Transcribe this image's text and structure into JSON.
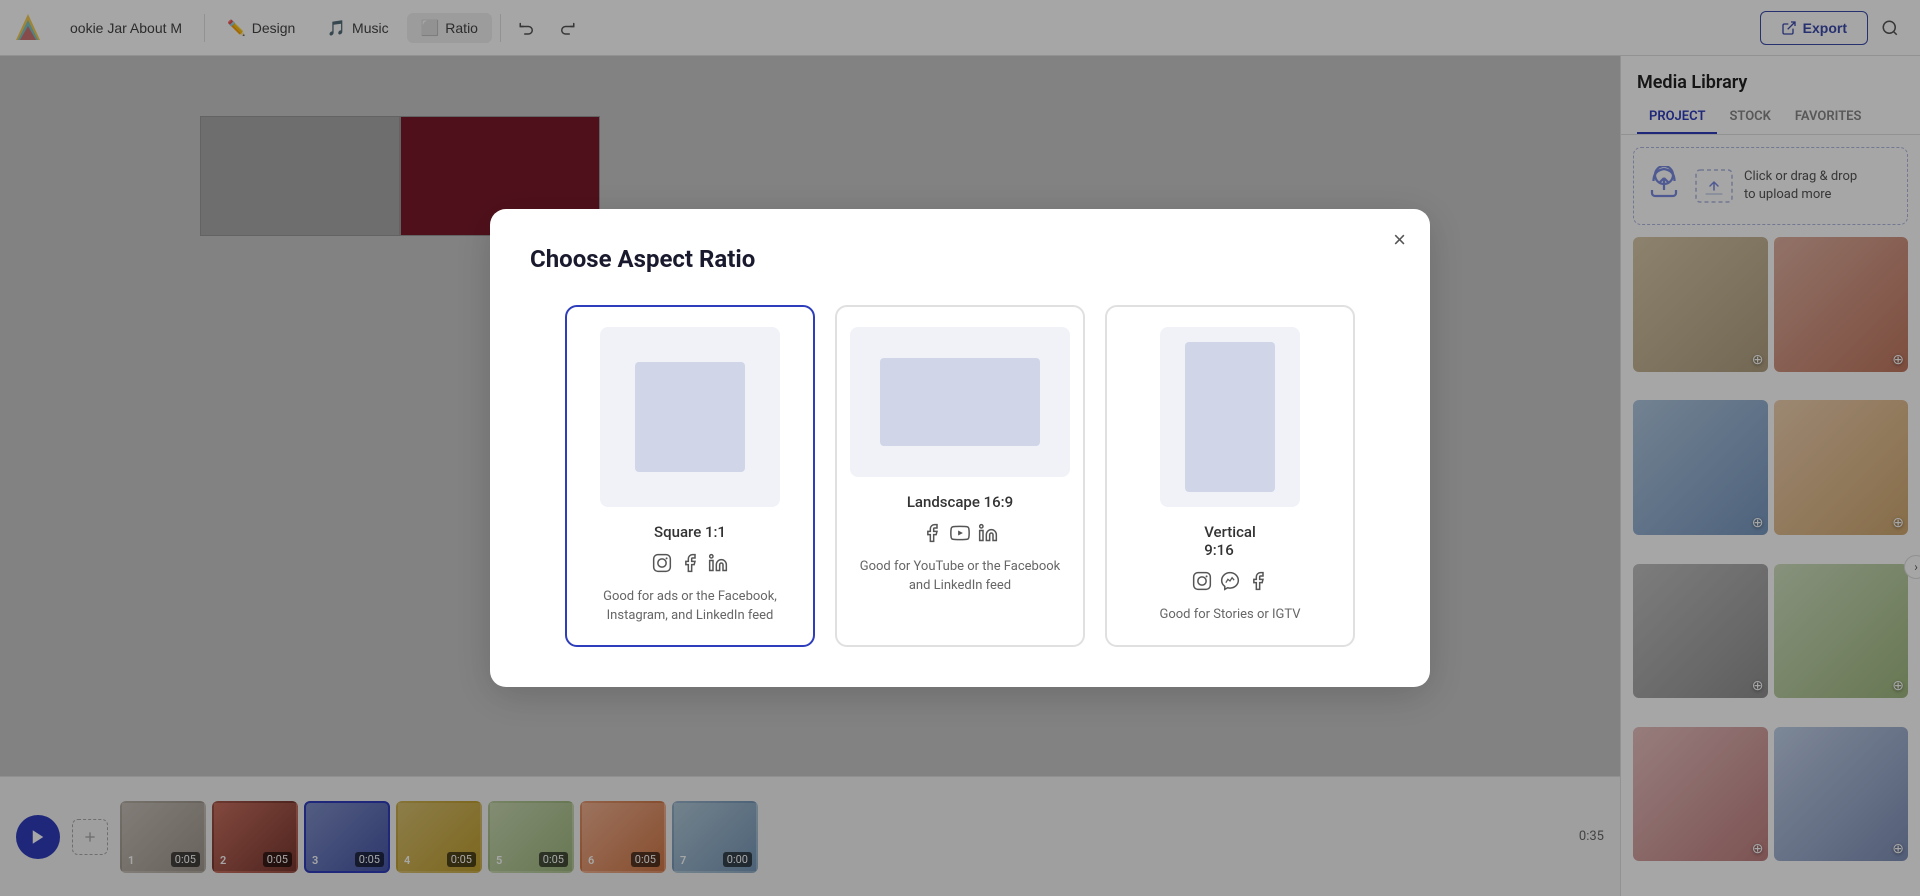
{
  "app": {
    "logo_alt": "App Logo"
  },
  "topnav": {
    "project_tab": "ookie Jar About M",
    "design_tab": "Design",
    "music_tab": "Music",
    "ratio_tab": "Ratio",
    "undo_title": "Undo",
    "redo_title": "Redo",
    "export_label": "Export",
    "search_title": "Search"
  },
  "media_library": {
    "title": "Media Library",
    "tabs": [
      "PROJECT",
      "STOCK",
      "FAVORITES"
    ],
    "upload_text": "Click or drag & drop\nto upload more"
  },
  "modal": {
    "title": "Choose Aspect Ratio",
    "close_label": "×",
    "options": [
      {
        "id": "square",
        "label": "Square 1:1",
        "icons": [
          "instagram",
          "facebook",
          "linkedin"
        ],
        "description": "Good for ads or the Facebook, Instagram, and LinkedIn feed",
        "selected": true
      },
      {
        "id": "landscape",
        "label": "Landscape 16:9",
        "icons": [
          "facebook",
          "youtube",
          "linkedin"
        ],
        "description": "Good for YouTube or the Facebook and LinkedIn feed",
        "selected": false
      },
      {
        "id": "vertical",
        "label": "Vertical\n9:16",
        "icons": [
          "instagram",
          "messenger",
          "facebook"
        ],
        "description": "Good for Stories or IGTV",
        "selected": false
      }
    ]
  },
  "timeline": {
    "counter": "0:35",
    "clips": [
      {
        "num": "1",
        "duration": "0:05"
      },
      {
        "num": "2",
        "duration": "0:05"
      },
      {
        "num": "3",
        "duration": "0:05"
      },
      {
        "num": "4",
        "duration": "0:05"
      },
      {
        "num": "5",
        "duration": "0:05"
      },
      {
        "num": "6",
        "duration": "0:05"
      },
      {
        "num": "7",
        "duration": "0:00"
      }
    ]
  }
}
